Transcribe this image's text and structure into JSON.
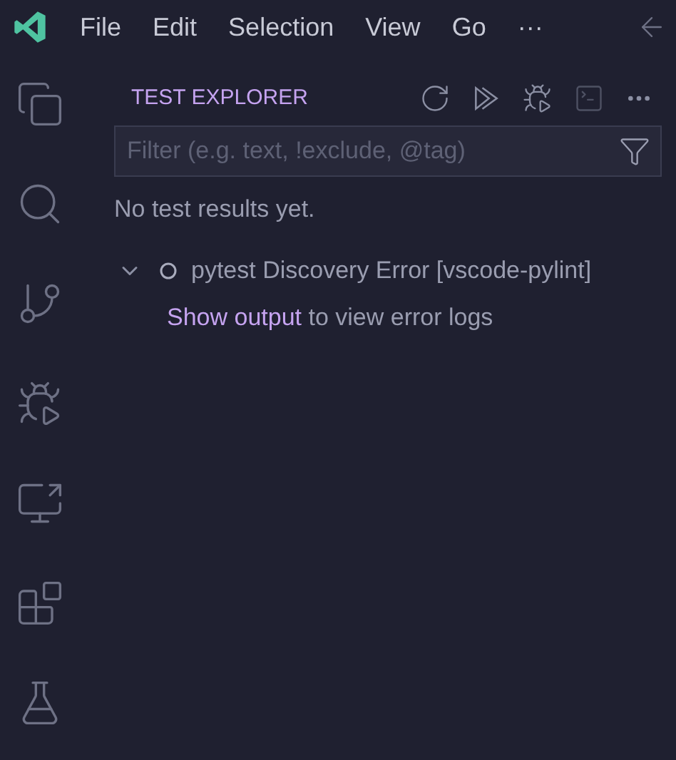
{
  "menu_bar": {
    "items": [
      "File",
      "Edit",
      "Selection",
      "View",
      "Go",
      "···"
    ]
  },
  "panel": {
    "title": "TEST EXPLORER"
  },
  "filter": {
    "placeholder": "Filter (e.g. text, !exclude, @tag)"
  },
  "message": "No test results yet.",
  "tree": [
    {
      "label": "pytest Discovery Error [vscode-pylint]",
      "expanded": true,
      "detail": {
        "link": "Show output",
        "text": "to view error logs"
      }
    }
  ]
}
